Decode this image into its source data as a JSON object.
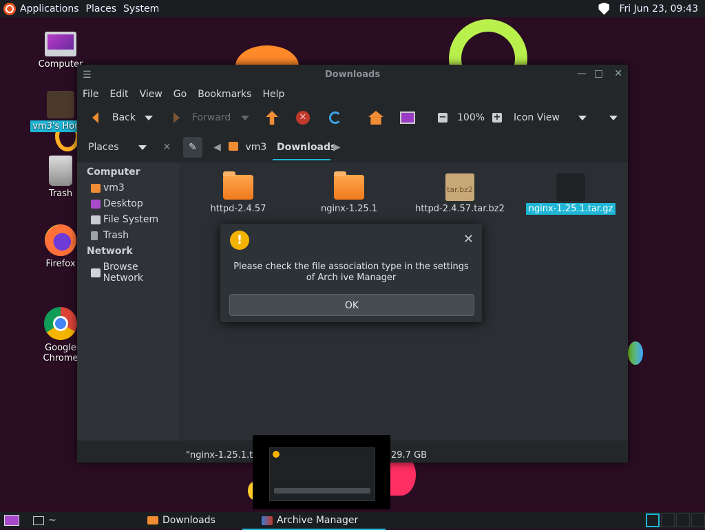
{
  "top_panel": {
    "menus": [
      "Applications",
      "Places",
      "System"
    ],
    "clock": "Fri Jun 23, 09:43"
  },
  "desktop_icons": [
    {
      "label": "Computer"
    },
    {
      "label": "vm3's Home"
    },
    {
      "label": "Trash"
    },
    {
      "label": "Firefox"
    },
    {
      "label": "Google Chrome"
    }
  ],
  "window": {
    "title": "Downloads",
    "menus": [
      "File",
      "Edit",
      "View",
      "Go",
      "Bookmarks",
      "Help"
    ],
    "toolbar": {
      "back": "Back",
      "forward": "Forward",
      "zoom": "100%",
      "view_mode": "Icon View"
    },
    "side": {
      "header": "Places",
      "sections": [
        {
          "title": "Computer",
          "items": [
            "vm3",
            "Desktop",
            "File System",
            "Trash"
          ]
        },
        {
          "title": "Network",
          "items": [
            "Browse Network"
          ]
        }
      ]
    },
    "breadcrumb": [
      "vm3",
      "Downloads"
    ],
    "files": [
      {
        "name": "httpd-2.4.57",
        "type": "folder"
      },
      {
        "name": "nginx-1.25.1",
        "type": "folder"
      },
      {
        "name": "httpd-2.4.57.tar.bz2",
        "type": "archive",
        "badge": "tar.bz2"
      },
      {
        "name": "nginx-1.25.1.tar.gz",
        "type": "archive",
        "selected": true
      }
    ],
    "status": {
      "text": "\"nginx-1.25.1.tar",
      "free": "29.7 GB"
    }
  },
  "dialog": {
    "message": "Please check the file association type in the settings of Arch ive Manager",
    "ok": "OK"
  },
  "taskbar": {
    "terminal": "~",
    "tasks": [
      "Downloads",
      "Archive Manager"
    ],
    "active_task": "Archive Manager"
  },
  "colors": {
    "accent": "#1fb6d6",
    "folder": "#f07a1c",
    "warning": "#f5b301"
  }
}
